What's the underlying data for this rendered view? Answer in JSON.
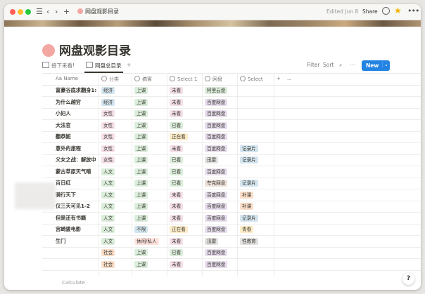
{
  "titlebar": {
    "title": "网盘观影目录",
    "edited": "Edited Jun 8",
    "share": "Share"
  },
  "page": {
    "title": "网盘观影目录",
    "emoji": "smiling-face-with-hearts"
  },
  "tabs": [
    {
      "label": "接下来看!"
    },
    {
      "label": "网盘总目录"
    },
    {
      "label": "+"
    }
  ],
  "toolbar": {
    "filter": "Filter",
    "sort": "Sort",
    "new": "New"
  },
  "columns": [
    "Aa Name",
    "分类",
    "搞賓",
    "Select 1",
    "网盘",
    "Select",
    "+",
    "..."
  ],
  "rows": [
    {
      "name": "富豪谷底求翻身1:",
      "c1": "经济",
      "c2": "上课",
      "c3": "未看",
      "c4": "阿里云盘",
      "c5": ""
    },
    {
      "name": "为什么越穷",
      "c1": "经济",
      "c2": "上课",
      "c3": "未看",
      "c4": "百度网盘",
      "c5": ""
    },
    {
      "name": "小妇人",
      "c1": "女性",
      "c2": "上课",
      "c3": "未看",
      "c4": "百度网盘",
      "c5": ""
    },
    {
      "name": "大法官",
      "c1": "女性",
      "c2": "上课",
      "c3": "已看",
      "c4": "百度网盘",
      "c5": ""
    },
    {
      "name": "翻恭妮",
      "c1": "女性",
      "c2": "上课",
      "c3": "正在看",
      "c4": "百度网盘",
      "c5": ""
    },
    {
      "name": "意外的旅程",
      "c1": "女性",
      "c2": "上课",
      "c3": "未看",
      "c4": "百度网盘",
      "c5": "记录片"
    },
    {
      "name": "父女之战：解放中",
      "c1": "女性",
      "c2": "上课",
      "c3": "已看",
      "c4": "迅雷",
      "c5": "记录片"
    },
    {
      "name": "蒙古草原天气晴",
      "c1": "人文",
      "c2": "上课",
      "c3": "已看",
      "c4": "百度网盘",
      "c5": ""
    },
    {
      "name": "百日红",
      "c1": "人文",
      "c2": "上课",
      "c3": "已看",
      "c4": "夸克网盘",
      "c5": "记录片"
    },
    {
      "name": "骑行天下",
      "c1": "人文",
      "c2": "上课",
      "c3": "未看",
      "c4": "百度网盘",
      "c5": "补课"
    },
    {
      "name": "仅三天可见1-2",
      "c1": "人文",
      "c2": "上课",
      "c3": "未看",
      "c4": "百度网盘",
      "c5": "补课"
    },
    {
      "name": "但是还有书籍",
      "c1": "人文",
      "c2": "上课",
      "c3": "未看",
      "c4": "百度网盘",
      "c5": "记录片"
    },
    {
      "name": "宫崎骏电影",
      "c1": "人文",
      "c2": "不限",
      "c3": "正在看",
      "c4": "百度网盘",
      "c5": "青春"
    },
    {
      "name": "生门",
      "c1": "人文",
      "c2": "休闲/私人",
      "c3": "未看",
      "c4": "迅雷",
      "c5": "性教育"
    },
    {
      "name": "",
      "c1": "社会",
      "c2": "上课",
      "c3": "已看",
      "c4": "百度网盘",
      "c5": ""
    },
    {
      "name": "",
      "c1": "社会",
      "c2": "上课",
      "c3": "未看",
      "c4": "百度网盘",
      "c5": ""
    }
  ],
  "footer": {
    "calculate": "Calculate"
  },
  "help": "?",
  "tag_colors": {
    "经济": "#d3e5ef",
    "女性": "#f5e0e9",
    "人文": "#dbeddb",
    "社会": "#fadec9",
    "上课": "#dbeddb",
    "不限": "#d3e5ef",
    "休闲/私人": "#ffe2dd",
    "未看": "#f5e0e9",
    "已看": "#dbeddb",
    "正在看": "#fdecc8",
    "阿里云盘": "#dbeddb",
    "百度网盘": "#e8deee",
    "迅雷": "#e3e2e0",
    "夸克网盘": "#eee0da",
    "记录片": "#d3e5ef",
    "补课": "#fadec9",
    "青春": "#fdecc8",
    "性教育": "#e3e2e0"
  }
}
